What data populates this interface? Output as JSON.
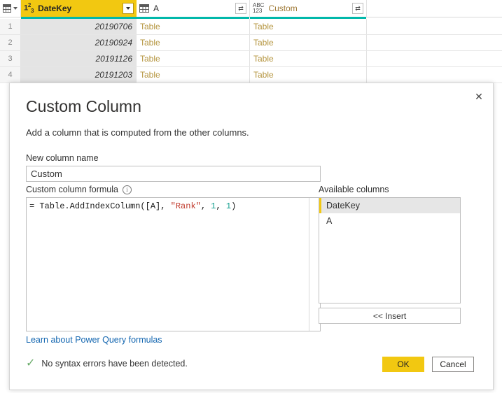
{
  "grid": {
    "corner_icon": "table-select-all-icon",
    "columns": [
      {
        "name": "DateKey",
        "type_icon": "whole-number-icon",
        "type_icon_label": "123",
        "selected": true,
        "has_dropdown": true,
        "has_expand": false
      },
      {
        "name": "A",
        "type_icon": "table-icon",
        "type_icon_label": "",
        "selected": false,
        "has_dropdown": false,
        "has_expand": true
      },
      {
        "name": "Custom",
        "type_icon": "any-text-icon",
        "type_icon_label": "ABC123",
        "selected": false,
        "has_dropdown": false,
        "has_expand": true
      }
    ],
    "rows": [
      {
        "num": "1",
        "DateKey": "20190706",
        "A": "Table",
        "Custom": "Table"
      },
      {
        "num": "2",
        "DateKey": "20190924",
        "A": "Table",
        "Custom": "Table"
      },
      {
        "num": "3",
        "DateKey": "20191126",
        "A": "Table",
        "Custom": "Table"
      },
      {
        "num": "4",
        "DateKey": "20191203",
        "A": "Table",
        "Custom": "Table"
      }
    ]
  },
  "dialog": {
    "title": "Custom Column",
    "subtitle": "Add a column that is computed from the other columns.",
    "close_label": "✕",
    "new_column_label": "New column name",
    "new_column_value": "Custom",
    "new_column_placeholder": "Custom",
    "formula_label": "Custom column formula",
    "info_icon_label": "i",
    "formula": {
      "full_text": "= Table.AddIndexColumn([A], \"Rank\", 1, 1)",
      "prefix": "= Table.AddIndexColumn([A], ",
      "string_literal": "\"Rank\"",
      "mid": ", ",
      "num1": "1",
      "sep": ", ",
      "num2": "1",
      "suffix": ")"
    },
    "learn_link": "Learn about Power Query formulas",
    "available_columns_label": "Available columns",
    "available_columns": [
      {
        "name": "DateKey",
        "selected": true
      },
      {
        "name": "A",
        "selected": false
      }
    ],
    "insert_label": "<< Insert",
    "status_icon": "checkmark-icon",
    "status_text": "No syntax errors have been detected.",
    "ok_label": "OK",
    "cancel_label": "Cancel"
  },
  "colors": {
    "accent_yellow": "#f2c811",
    "teal_underline": "#01b8aa",
    "link_blue": "#1366b0",
    "status_green": "#6aab6a",
    "string_red": "#c0392b",
    "number_teal": "#0f9e8e",
    "new_column_header_text": "#a07b38"
  }
}
